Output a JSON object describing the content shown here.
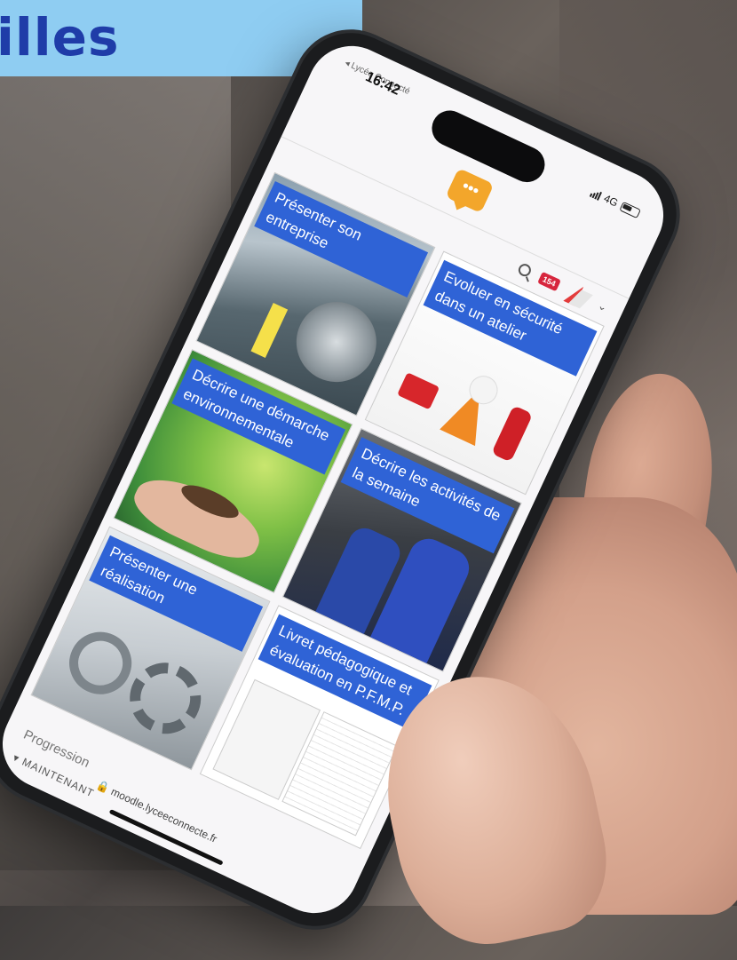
{
  "banner": {
    "text": "illes"
  },
  "status_bar": {
    "back_app": "◂ Lycée Connecté",
    "time": "16:42",
    "network": "4G"
  },
  "header": {
    "logo_glyph": "•••",
    "notification_count": "154",
    "chevron": "⌄"
  },
  "tiles": [
    {
      "title": "Présenter son entreprise"
    },
    {
      "title": "Evoluer en sécurité dans un atelier"
    },
    {
      "title": "Décrire une démarche environnementale"
    },
    {
      "title": "Décrire les activités de la semaine"
    },
    {
      "title": "Présenter une réalisation"
    },
    {
      "title": "Livret pédagogique et évaluation en P.F.M.P."
    }
  ],
  "footer": {
    "progress_label": "Progression",
    "now_label": "▾ MAINTENANT",
    "url": "🔒 moodle.lyceeconnecte.fr"
  },
  "colors": {
    "banner_bg": "#8fcdf2",
    "banner_text": "#1f3ca8",
    "tile_title_bg": "#2f63d6",
    "logo": "#f3a62b",
    "badge": "#d7263d"
  }
}
